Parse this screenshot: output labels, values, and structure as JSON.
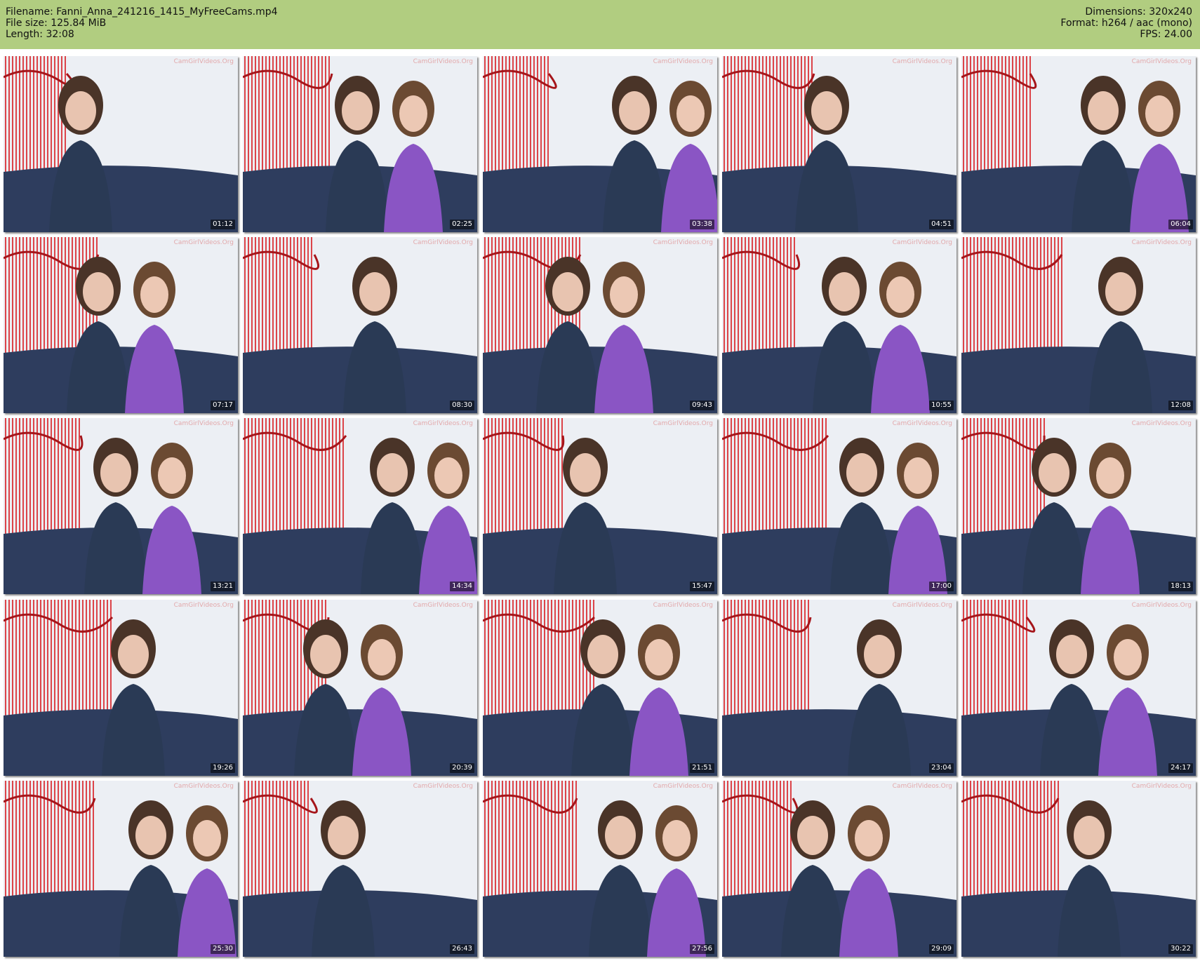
{
  "header": {
    "filename": "Filename: Fanni_Anna_241216_1415_MyFreeCams.mp4",
    "filesize": "File size: 125.84 MiB",
    "length": "Length: 32:08",
    "dimensions": "Dimensions: 320x240",
    "format": "Format: h264 / aac (mono)",
    "fps": "FPS: 24.00"
  },
  "watermark": "CamGirlVideos.Org",
  "colors": {
    "header_bg": "#b1cd80",
    "curtain_red": "#d9262a",
    "sofa_blue": "#2e3d5e",
    "wall": "#eceff4"
  },
  "thumbnails": [
    {
      "time": "01:12"
    },
    {
      "time": "02:25"
    },
    {
      "time": "03:38"
    },
    {
      "time": "04:51"
    },
    {
      "time": "06:04"
    },
    {
      "time": "07:17"
    },
    {
      "time": "08:30"
    },
    {
      "time": "09:43"
    },
    {
      "time": "10:55"
    },
    {
      "time": "12:08"
    },
    {
      "time": "13:21"
    },
    {
      "time": "14:34"
    },
    {
      "time": "15:47"
    },
    {
      "time": "17:00"
    },
    {
      "time": "18:13"
    },
    {
      "time": "19:26"
    },
    {
      "time": "20:39"
    },
    {
      "time": "21:51"
    },
    {
      "time": "23:04"
    },
    {
      "time": "24:17"
    },
    {
      "time": "25:30"
    },
    {
      "time": "26:43"
    },
    {
      "time": "27:56"
    },
    {
      "time": "29:09"
    },
    {
      "time": "30:22"
    }
  ]
}
